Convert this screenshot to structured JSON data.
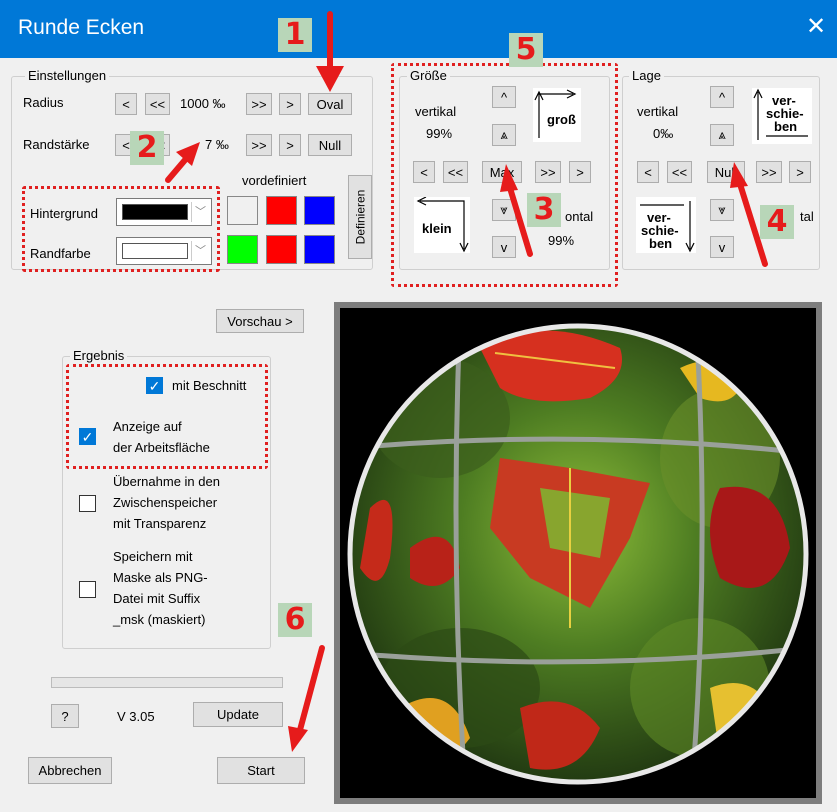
{
  "window": {
    "title": "Runde Ecken",
    "close_glyph": "✕"
  },
  "settings": {
    "group_label": "Einstellungen",
    "radius_label": "Radius",
    "radius_value": "1000 ‰",
    "thickness_label": "Randstärke",
    "thickness_value": "7 ‰",
    "btn_less": "<",
    "btn_much_less": "<<",
    "btn_much_more": ">>",
    "btn_more": ">",
    "oval_label": "Oval",
    "null_label": "Null",
    "predefined_label": "vordefiniert",
    "background_label": "Hintergrund",
    "border_color_label": "Randfarbe",
    "background_color": "#000000",
    "border_color": "#ffffff",
    "define_label": "Definieren",
    "presets_row1": [
      "#f0f0f0",
      "#ff0000",
      "#0000ff"
    ],
    "presets_row2": [
      "#00ff00",
      "#ff0000",
      "#0000ff"
    ]
  },
  "size": {
    "group_label": "Größe",
    "vertical_label": "vertikal",
    "vertical_value": "99%",
    "horizontal_label_visible": "ontal",
    "horizontal_value": "99%",
    "up": "^",
    "fast_up": "⩓",
    "fast_down": "⩔",
    "down": "v",
    "max_label": "Max",
    "big_icon_label": "groß",
    "small_icon_label": "klein"
  },
  "position": {
    "group_label": "Lage",
    "vertical_label": "vertikal",
    "vertical_value": "0‰",
    "horizontal_label_visible": "ho",
    "horizontal_label_tail": "tal",
    "null_label": "Null",
    "shift_label_1": "ver-",
    "shift_label_2": "schie-",
    "shift_label_3": "ben"
  },
  "preview_button": "Vorschau >",
  "result": {
    "group_label": "Ergebnis",
    "opt_crop": "mit Beschnitt",
    "opt_crop_checked": true,
    "opt_display": "Anzeige auf\nder Arbeitsfläche",
    "opt_display_checked": true,
    "opt_clipboard": "Übernahme in den\nZwischenspeicher\nmit Transparenz",
    "opt_clipboard_checked": false,
    "opt_save": "Speichern mit\nMaske als PNG-\nDatei mit Suffix\n_msk (maskiert)",
    "opt_save_checked": false
  },
  "footer": {
    "help_label": "?",
    "version": "V 3.05",
    "update_label": "Update",
    "cancel_label": "Abbrechen",
    "start_label": "Start",
    "progress": 0
  },
  "annotations": [
    "1",
    "2",
    "3",
    "4",
    "5",
    "6"
  ],
  "colors": {
    "accent": "#0078d7",
    "annotation_red": "#e61b1b",
    "annotation_badge": "#b8d6b8"
  }
}
